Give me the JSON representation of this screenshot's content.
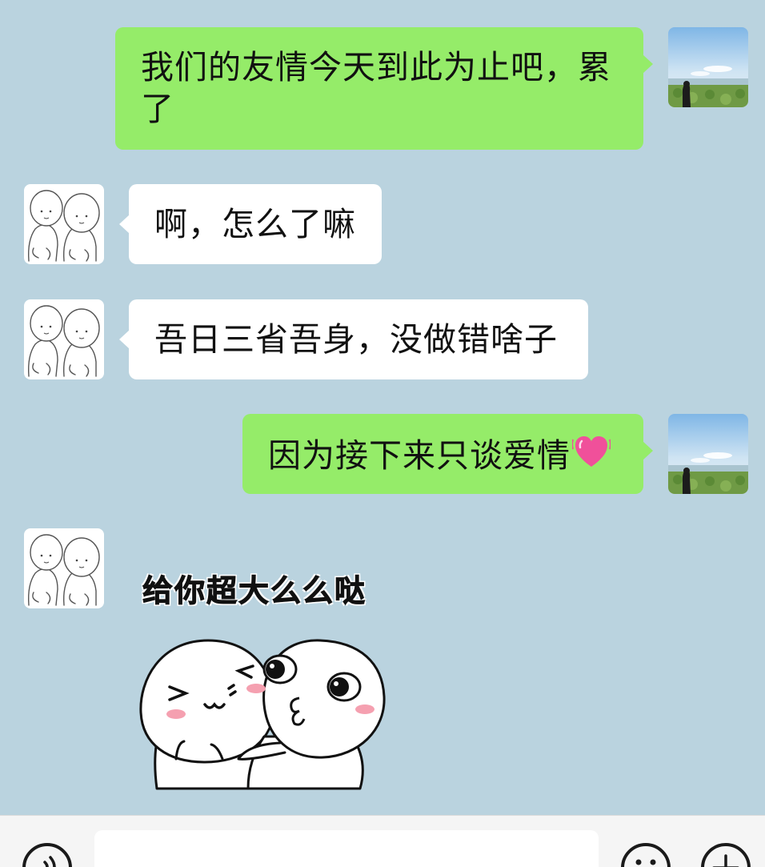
{
  "colors": {
    "background": "#bad3df",
    "outgoing_bubble": "#95ec69",
    "incoming_bubble": "#ffffff"
  },
  "messages": [
    {
      "direction": "outgoing",
      "type": "text",
      "text": "我们的友情今天到此为止吧，累了"
    },
    {
      "direction": "incoming",
      "type": "text",
      "text": "啊，怎么了嘛"
    },
    {
      "direction": "incoming",
      "type": "text",
      "text": "吾日三省吾身，没做错啥子"
    },
    {
      "direction": "outgoing",
      "type": "text",
      "text": "因为接下来只谈爱情",
      "emoji": "heart-icon"
    },
    {
      "direction": "incoming",
      "type": "sticker",
      "caption": "给你超大么么哒",
      "image": "kiss-sticker"
    }
  ],
  "input_bar": {
    "left_button_icon": "voice-icon",
    "input_value": "",
    "emoji_button_icon": "emoji-icon",
    "plus_button_icon": "plus-icon"
  }
}
